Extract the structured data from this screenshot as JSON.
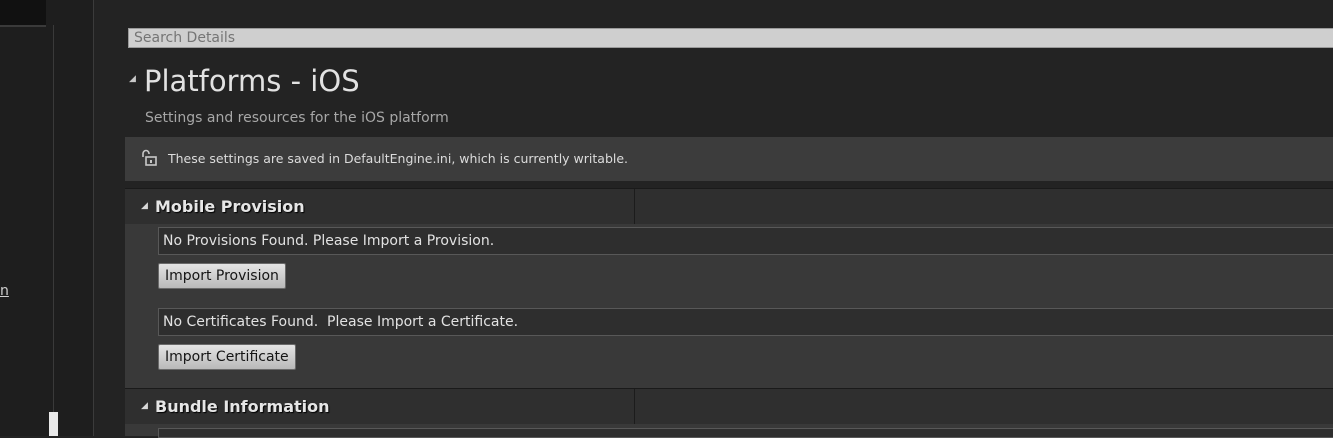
{
  "left_panel": {
    "partial_label": "n"
  },
  "search": {
    "placeholder": "Search Details",
    "value": ""
  },
  "page": {
    "title": "Platforms - iOS",
    "subtitle": "Settings and resources for the iOS platform"
  },
  "notice": {
    "icon": "unlocked-padlock-icon",
    "text": "These settings are saved in DefaultEngine.ini, which is currently writable."
  },
  "mobile_provision": {
    "title": "Mobile Provision",
    "provisions_status": "No Provisions Found. Please Import a Provision.",
    "import_provision_label": "Import Provision",
    "certificates_status": "No Certificates Found.  Please Import a Certificate.",
    "import_certificate_label": "Import Certificate"
  },
  "bundle_information": {
    "title": "Bundle Information"
  }
}
